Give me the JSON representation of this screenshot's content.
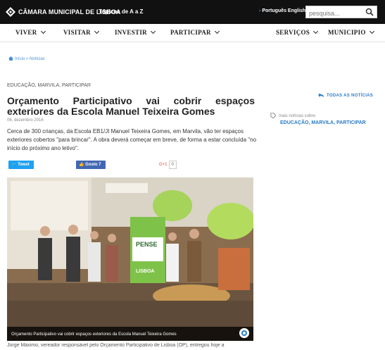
{
  "topbar": {
    "brand": "CÂMARA MUNICIPAL DE LISBOA",
    "topics": "Tópicos de A a Z",
    "lang": "Português English",
    "search_placeholder": "pesquisa..."
  },
  "nav": {
    "items": [
      "VIVER",
      "VISITAR",
      "INVESTIR",
      "PARTICIPAR",
      "SERVIÇOS",
      "MUNICIPIO"
    ]
  },
  "breadcrumb": "Início » Notícias",
  "article": {
    "categories": "EDUCAÇÃO, MARVILA, PARTICIPAR",
    "title": "Orçamento Participativo vai cobrir espaços exteriores da Escola Manuel Teixeira Gomes",
    "date": "06, dezembro 2016",
    "lead": "Cerca de 300 crianças, da Escola EB1/JI Manuel Teixeira Gomes, em Marvila, vão ter espaços exteriores cobertos \"para brincar\". A obra deverá começar em breve, de forma a estar concluída \"no início do próximo ano letivo\".",
    "photo_caption": "Orçamento Participativo vai cobrir espaços exteriores da Escola Manuel Teixeira Gomes",
    "photo_banner": "PENSE",
    "photo_banner_sub": "LISBOA",
    "body_start": "Jorge Máximo, vereador responsável pelo Orçamento Participativo de Lisboa (OP), entregou hoje a"
  },
  "share": {
    "tweet": "Tweet",
    "like": "Gosto 7",
    "gplus": "G+1",
    "gplus_count": "0"
  },
  "sidebar": {
    "all_news": "TODAS AS NOTÍCIAS",
    "more_label": "mais notícias sobre:",
    "categories": "EDUCAÇÃO, MARVILA, PARTICIPAR"
  },
  "colors": {
    "topbar": "#111111",
    "link": "#2a7cc7",
    "tweet": "#1da1f2",
    "facebook": "#4267b2"
  }
}
